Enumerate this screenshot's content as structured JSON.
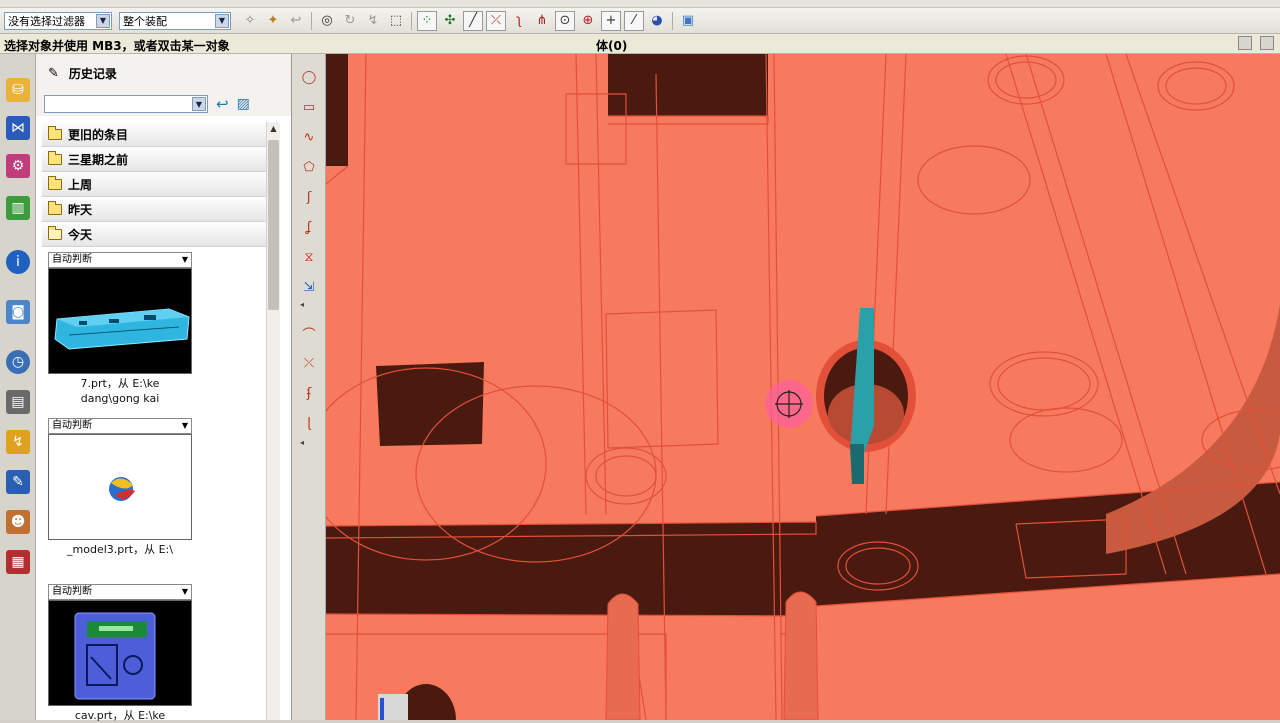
{
  "toolbar": {
    "selection_filter": "没有选择过滤器",
    "assembly_scope": "整个装配"
  },
  "status": {
    "prompt": "选择对象并使用 MB3，或者双击某一对象",
    "selection": "体(0)"
  },
  "history_panel": {
    "title": "历史记录",
    "groups": [
      {
        "label": "更旧的条目"
      },
      {
        "label": "三星期之前"
      },
      {
        "label": "上周"
      },
      {
        "label": "昨天"
      },
      {
        "label": "今天"
      }
    ],
    "entries": [
      {
        "mode": "自动判断",
        "caption_line1": "7.prt，从 E:\\ke",
        "caption_line2": "dang\\gong kai"
      },
      {
        "mode": "自动判断",
        "caption_line1": "_model3.prt，从 E:\\",
        "caption_line2": ""
      },
      {
        "mode": "自动判断",
        "caption_line1": "cav.prt，从 E:\\ke",
        "caption_line2": ""
      }
    ]
  },
  "viewport": {
    "body_color": "#f77a5e",
    "edge_color": "#e2503a",
    "shadow_color": "#4a1a10",
    "highlight_color": "#2aa0a8"
  }
}
